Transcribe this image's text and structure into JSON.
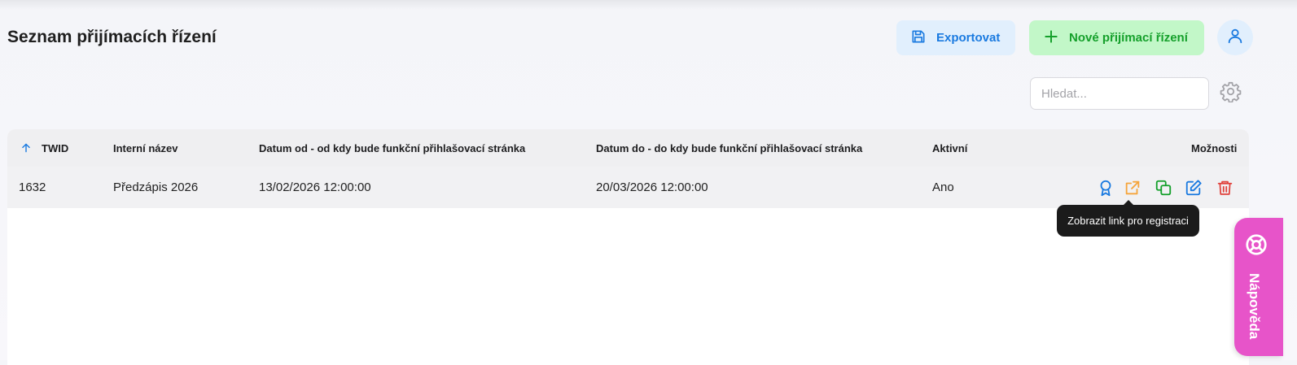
{
  "header": {
    "title": "Seznam přijímacích řízení",
    "export_label": "Exportovat",
    "new_label": "Nové přijímací řízení"
  },
  "search": {
    "placeholder": "Hledat...",
    "value": ""
  },
  "table": {
    "columns": [
      "TWID",
      "Interní název",
      "Datum od - od kdy bude funkční přihlašovací stránka",
      "Datum do - do kdy bude funkční přihlašovací stránka",
      "Aktivní",
      "Možnosti"
    ],
    "sort": {
      "column": "TWID",
      "direction": "asc"
    },
    "rows": [
      {
        "twid": "1632",
        "name": "Předzápis 2026",
        "date_from": "13/02/2026 12:00:00",
        "date_to": "20/03/2026 12:00:00",
        "active": "Ano"
      }
    ],
    "row_actions": [
      "award-icon",
      "external-link-icon",
      "copy-icon",
      "edit-icon",
      "trash-icon"
    ]
  },
  "tooltip": "Zobrazit link pro registraci",
  "help_tab": {
    "label": "Nápověda"
  },
  "colors": {
    "blue": "#1a7ae0",
    "green": "#15a02b",
    "orange": "#f5a53c",
    "red": "#e0403a",
    "pink": "#e754c9"
  }
}
